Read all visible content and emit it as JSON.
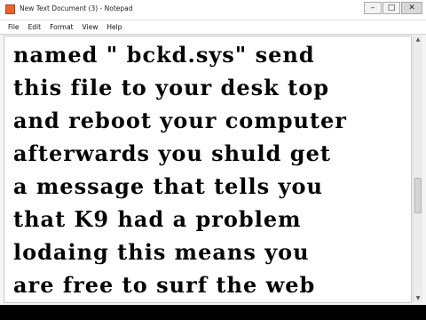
{
  "window": {
    "title": "New Text Document (3) - Notepad",
    "controls": {
      "minimize_glyph": "–",
      "maximize_glyph": "□",
      "close_glyph": "✕"
    }
  },
  "menu": {
    "items": [
      {
        "label": "File"
      },
      {
        "label": "Edit"
      },
      {
        "label": "Format"
      },
      {
        "label": "View"
      },
      {
        "label": "Help"
      }
    ]
  },
  "document": {
    "lines": [
      "named  \" bckd.sys\" send",
      "this file to your desk top",
      "and reboot your computer",
      "afterwards  you shuld get",
      "a message that tells you",
      "that K9 had a problem",
      "lodaing this  means you",
      "are free to surf the web"
    ]
  },
  "scrollbar": {
    "up_glyph": "▲",
    "down_glyph": "▼"
  },
  "colors": {
    "notepad_icon": "#e8632b",
    "text": "#050505",
    "letterbox": "#000000"
  }
}
